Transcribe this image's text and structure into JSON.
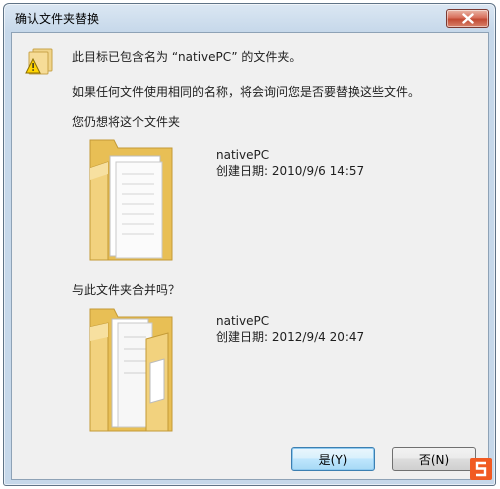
{
  "window": {
    "title": "确认文件夹替换",
    "close_icon": "close-icon"
  },
  "messages": {
    "line1": "此目标已包含名为 “nativePC” 的文件夹。",
    "line2": "如果任何文件使用相同的名称，将会询问您是否要替换这些文件。",
    "line3": "您仍想将这个文件夹",
    "line4": "与此文件夹合并吗？"
  },
  "folders": [
    {
      "name": "nativePC",
      "created": "创建日期: 2010/9/6 14:57"
    },
    {
      "name": "nativePC",
      "created": "创建日期: 2012/9/4 20:47"
    }
  ],
  "buttons": {
    "yes": "是(Y)",
    "no": "否(N)"
  },
  "icons": {
    "warning": "folder-warning-icon",
    "logo": "site-logo-icon"
  },
  "colors": {
    "title_bar": "#c6d8ea",
    "client_bg": "#f0f0f0",
    "close_button": "#c24a33",
    "folder": "#f3d27a",
    "logo": "#f15a22"
  }
}
